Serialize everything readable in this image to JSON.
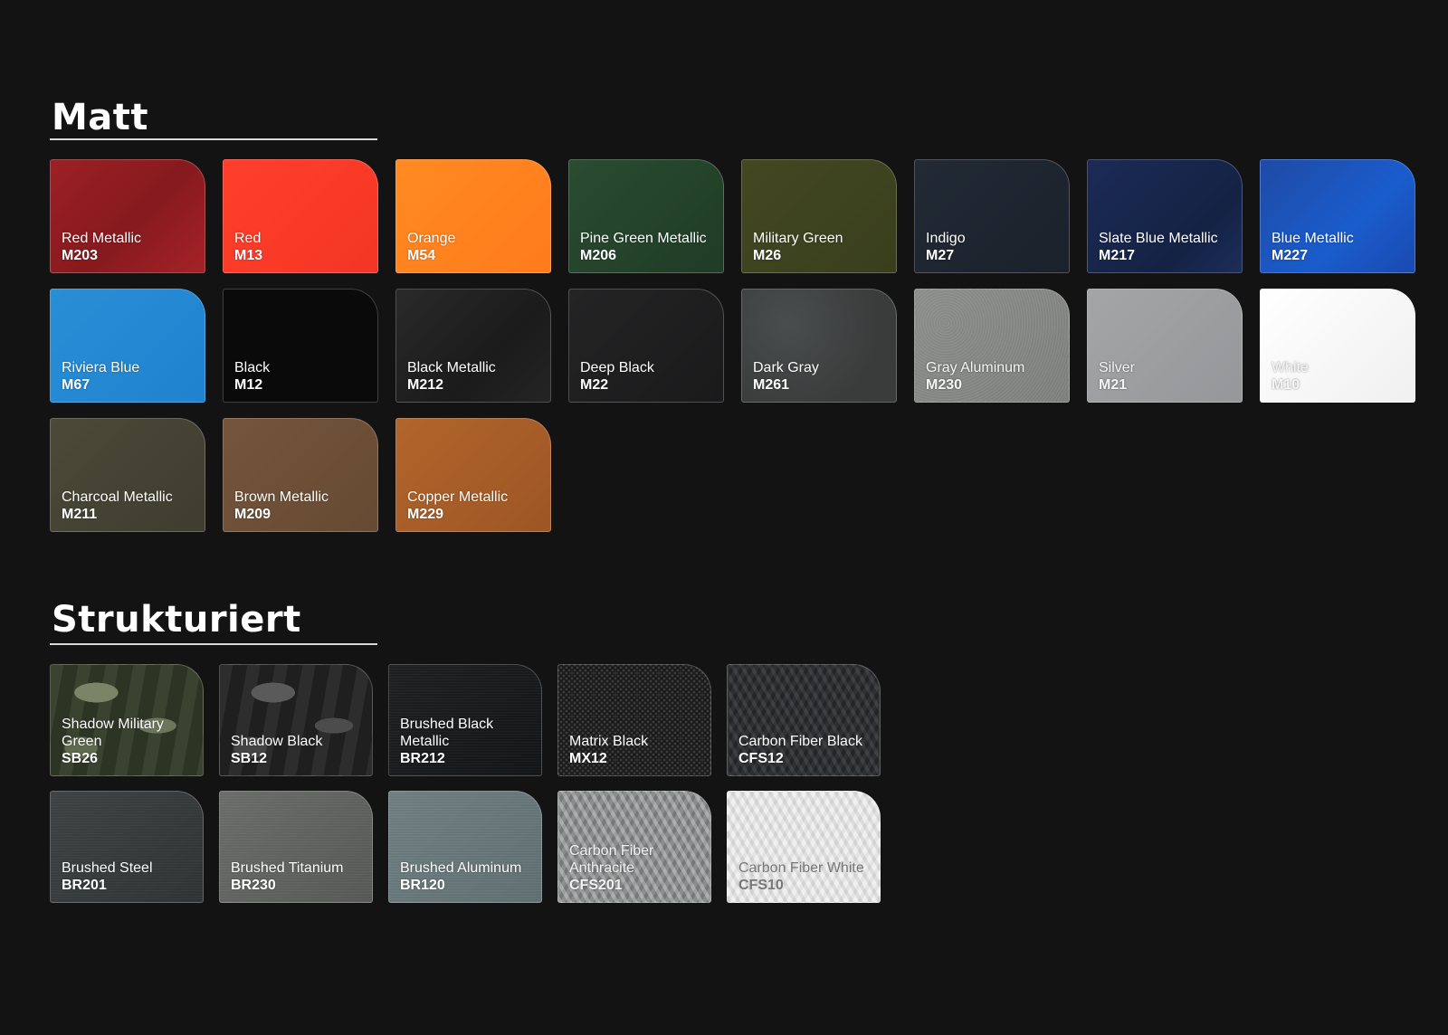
{
  "sections": [
    {
      "title": "Matt",
      "swatches": [
        {
          "name": "Red Metallic",
          "code": "M203",
          "swatch": "red-metallic"
        },
        {
          "name": "Red",
          "code": "M13",
          "swatch": "red"
        },
        {
          "name": "Orange",
          "code": "M54",
          "swatch": "orange"
        },
        {
          "name": "Pine Green Metallic",
          "code": "M206",
          "swatch": "pine-green"
        },
        {
          "name": "Military Green",
          "code": "M26",
          "swatch": "military-green"
        },
        {
          "name": "Indigo",
          "code": "M27",
          "swatch": "indigo"
        },
        {
          "name": "Slate Blue Metallic",
          "code": "M217",
          "swatch": "slate-blue"
        },
        {
          "name": "Blue Metallic",
          "code": "M227",
          "swatch": "blue-metallic"
        },
        {
          "name": "Riviera Blue",
          "code": "M67",
          "swatch": "riviera-blue"
        },
        {
          "name": "Black",
          "code": "M12",
          "swatch": "black"
        },
        {
          "name": "Black Metallic",
          "code": "M212",
          "swatch": "black-metallic"
        },
        {
          "name": "Deep Black",
          "code": "M22",
          "swatch": "deep-black"
        },
        {
          "name": "Dark Gray",
          "code": "M261",
          "swatch": "dark-gray"
        },
        {
          "name": "Gray Aluminum",
          "code": "M230",
          "swatch": "gray-aluminum"
        },
        {
          "name": "Silver",
          "code": "M21",
          "swatch": "silver"
        },
        {
          "name": "White",
          "code": "M10",
          "swatch": "white"
        },
        {
          "name": "Charcoal Metallic",
          "code": "M211",
          "swatch": "charcoal"
        },
        {
          "name": "Brown Metallic",
          "code": "M209",
          "swatch": "brown"
        },
        {
          "name": "Copper Metallic",
          "code": "M229",
          "swatch": "copper"
        }
      ]
    },
    {
      "title": "Strukturiert",
      "swatches": [
        {
          "name": "Shadow Military Green",
          "code": "SB26",
          "swatch": "shadow-green"
        },
        {
          "name": "Shadow Black",
          "code": "SB12",
          "swatch": "shadow-black"
        },
        {
          "name": "Brushed Black Metallic",
          "code": "BR212",
          "swatch": "brushed-black"
        },
        {
          "name": "Matrix Black",
          "code": "MX12",
          "swatch": "matrix-black"
        },
        {
          "name": "Carbon Fiber Black",
          "code": "CFS12",
          "swatch": "cf-black"
        },
        {
          "name": "Brushed Steel",
          "code": "BR201",
          "swatch": "brushed-steel"
        },
        {
          "name": "Brushed Titanium",
          "code": "BR230",
          "swatch": "brushed-titanium"
        },
        {
          "name": "Brushed Aluminum",
          "code": "BR120",
          "swatch": "brushed-aluminum"
        },
        {
          "name": "Carbon Fiber Anthracite",
          "code": "CFS201",
          "swatch": "cf-anthracite"
        },
        {
          "name": "Carbon Fiber White",
          "code": "CFS10",
          "swatch": "cf-white"
        }
      ]
    }
  ]
}
